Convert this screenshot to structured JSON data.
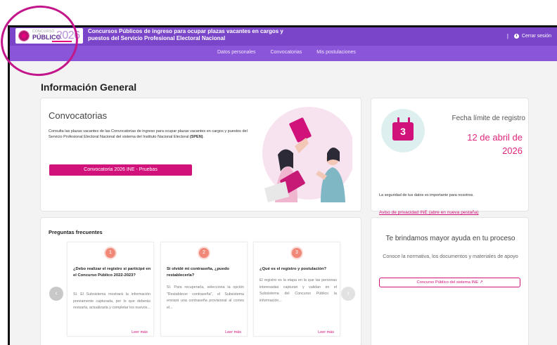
{
  "header": {
    "logo": {
      "concurso": "CONCURSO",
      "publico": "PÚBLICO",
      "year": "2026",
      "sub": "SERVICIO PROFESIONAL ELECTORAL NACIONAL"
    },
    "title": "Concursos Públicos de ingreso para ocupar plazas vacantes en cargos y puestos del Servicio Profesional Electoral Nacional",
    "separator": "|",
    "logout_label": "Cerrar sesión"
  },
  "nav": {
    "items": [
      {
        "label": "Datos personales"
      },
      {
        "label": "Convocatorias"
      },
      {
        "label": "Mis postulaciones"
      }
    ]
  },
  "page": {
    "title": "Información General"
  },
  "convocatorias": {
    "title": "Convocatorias",
    "description_main": "Consulta las plazas vacantes de las Convocatorias de ingreso para ocupar plazas vacantes en cargos y puestos del Servicio Profesional Electoral Nacional del sistema del Instituto Nacional Electoral",
    "description_bold": "(SPEN)",
    "button_label": "Convocatoria 2026 INE - Pruebas"
  },
  "deadline": {
    "label": "Fecha límite de registro",
    "date_line1": "12 de abril de",
    "date_line2": "2026",
    "calendar_day": "3",
    "security_text": "La seguridad de tus datos es importante para nosotros.",
    "privacy_link": "Aviso de privacidad INE (abre en nueva pestaña)"
  },
  "faq": {
    "title": "Preguntas frecuentes",
    "read_more": "Leer más",
    "items": [
      {
        "number": "1",
        "question": "¿Debo realizar el registro si participé en el Concurso Público 2022-2023?",
        "answer": "Sí. El Subsistema mostrará la información previamente capturada, por lo que deberás revisarla, actualizarla y completar los nuevos..."
      },
      {
        "number": "2",
        "question": "Si olvidé mi contraseña, ¿puedo restablecerla?",
        "answer": "Sí. Para recuperarla, selecciona la opción \"Restablecer contraseña\", el Subsistema enviará una contraseña provisional al correo el..."
      },
      {
        "number": "3",
        "question": "¿Qué es el registro y postulación?",
        "answer": "El registro es la etapa en la que las personas interesadas capturan y validan en el Subsistema del Concurso Público la información..."
      }
    ]
  },
  "help": {
    "title": "Te brindamos mayor ayuda en tu proceso",
    "description": "Conoce la normativa, los documentos y materiales de apoyo",
    "button_label": "Concurso Público del sistema INE"
  },
  "colors": {
    "header_purple": "#7a45c9",
    "nav_purple": "#8b55d9",
    "accent_magenta": "#d1127a",
    "annotation": "#c2168a"
  }
}
